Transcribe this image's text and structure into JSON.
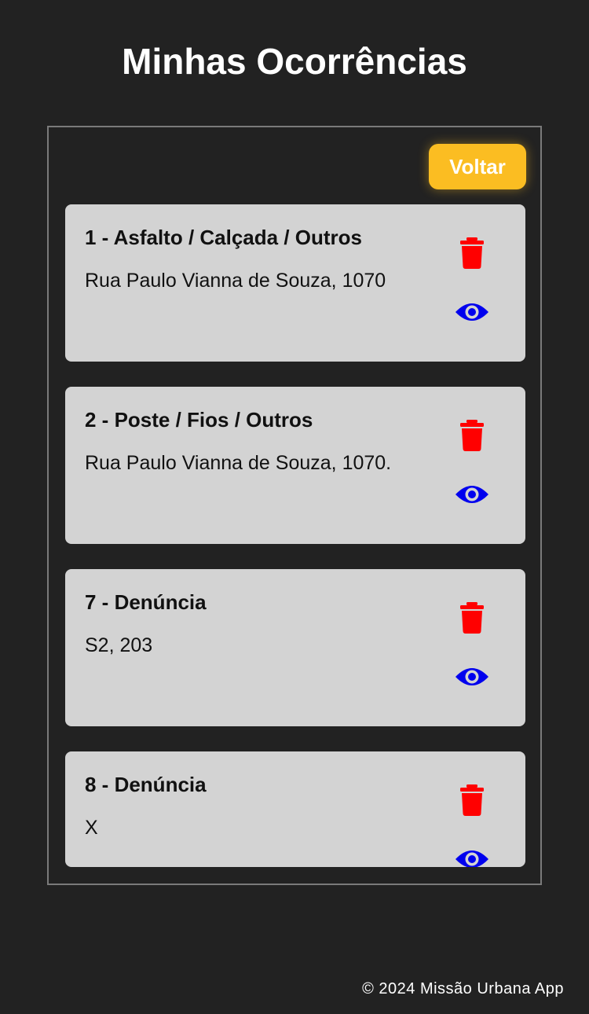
{
  "header": {
    "title": "Minhas Ocorrências"
  },
  "toolbar": {
    "back_label": "Voltar"
  },
  "occurrences": [
    {
      "title": "1 - Asfalto / Calçada / Outros",
      "address": "Rua Paulo Vianna de Souza, 1070"
    },
    {
      "title": "2 - Poste / Fios / Outros",
      "address": "Rua Paulo Vianna de Souza, 1070."
    },
    {
      "title": "7 - Denúncia",
      "address": "S2, 203"
    },
    {
      "title": "8 - Denúncia",
      "address": "X"
    }
  ],
  "footer": {
    "text": "© 2024 Missão Urbana App"
  },
  "icons": {
    "delete": "trash-icon",
    "view": "eye-icon"
  },
  "colors": {
    "background": "#222222",
    "accent": "#fbbd22",
    "card": "#d3d3d3",
    "delete": "#ff0000",
    "view": "#0000ee"
  }
}
